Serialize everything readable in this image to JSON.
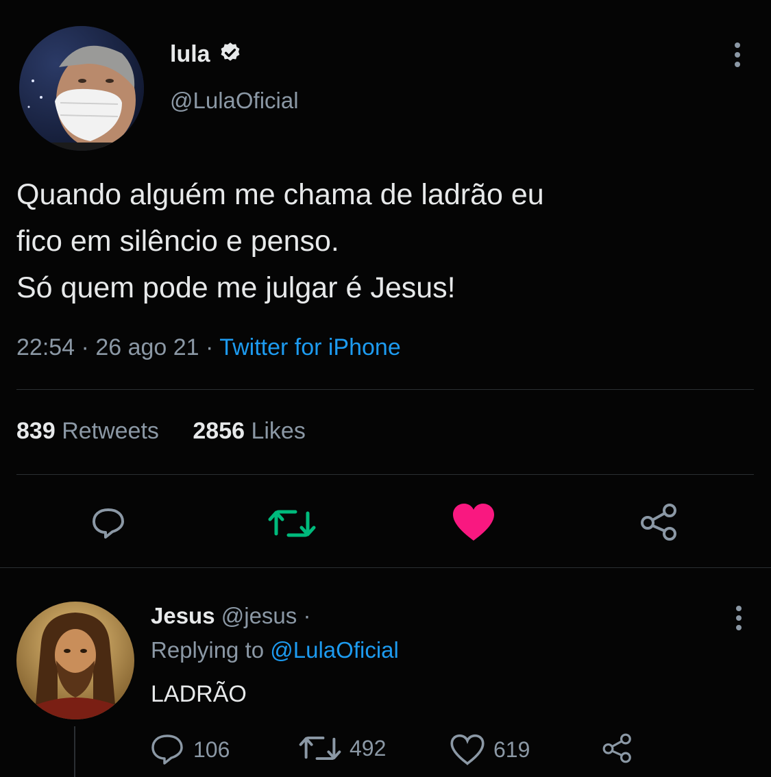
{
  "tweet": {
    "display_name": "lula",
    "verified_icon": "verified-badge-icon",
    "handle": "@LulaOficial",
    "text_lines": [
      "Quando alguém me chama de ladrão eu",
      "fico em silêncio e penso.",
      "Só quem pode me julgar é Jesus!"
    ],
    "time": "22:54",
    "separator": " · ",
    "date": "26 ago 21",
    "source": "Twitter for iPhone",
    "retweets_count": "839",
    "retweets_label": "Retweets",
    "likes_count": "2856",
    "likes_label": "Likes",
    "colors": {
      "retweet_active": "#00ba7c",
      "like_active": "#f91880",
      "link": "#1d9bf0"
    }
  },
  "reply": {
    "display_name": "Jesus",
    "handle": "@jesus",
    "dot": " ·",
    "replying_prefix": "Replying to ",
    "replying_handle": "@LulaOficial",
    "text": "LADRÃO",
    "reply_count": "106",
    "retweet_count": "492",
    "like_count": "619"
  }
}
